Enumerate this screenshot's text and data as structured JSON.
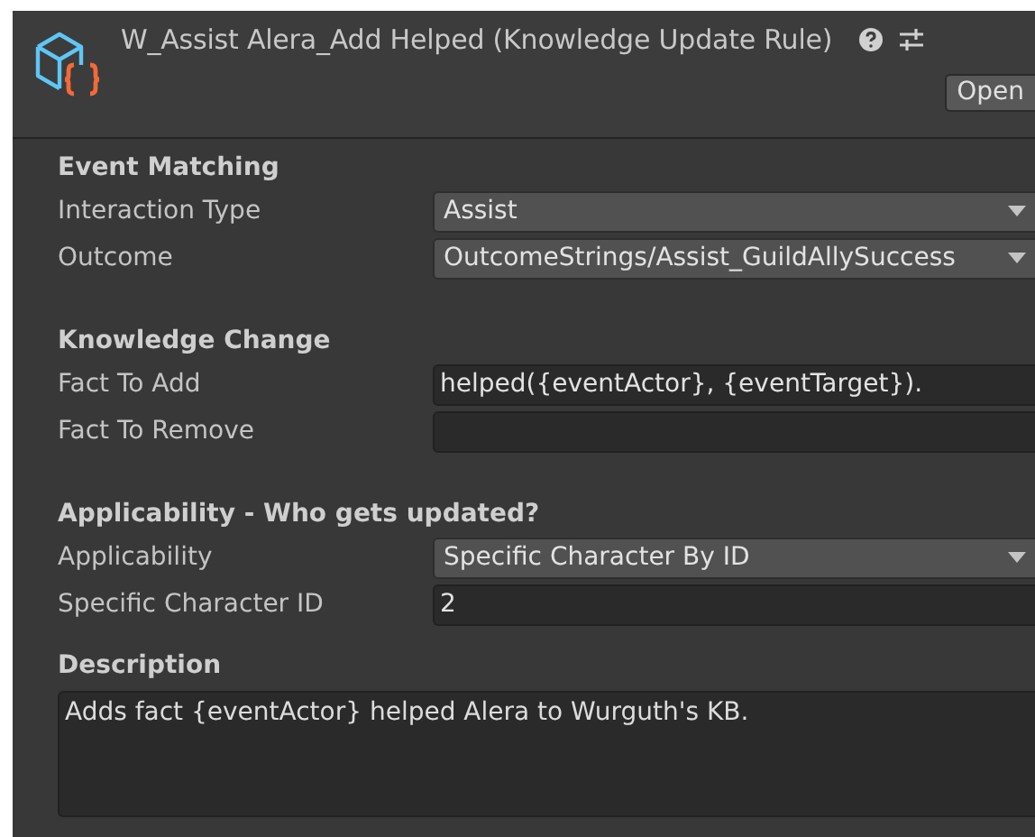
{
  "header": {
    "title": "W_Assist Alera_Add Helped (Knowledge Update Rule)",
    "open_button": "Open"
  },
  "sections": [
    {
      "title": "Event Matching",
      "fields": [
        {
          "label": "Interaction Type",
          "kind": "dropdown",
          "value": "Assist"
        },
        {
          "label": "Outcome",
          "kind": "dropdown",
          "value": "OutcomeStrings/Assist_GuildAllySuccess"
        }
      ]
    },
    {
      "title": "Knowledge Change",
      "fields": [
        {
          "label": "Fact To Add",
          "kind": "text",
          "value": "helped({eventActor}, {eventTarget})."
        },
        {
          "label": "Fact To Remove",
          "kind": "text"
        }
      ]
    },
    {
      "title": "Applicability - Who gets updated?",
      "fields": [
        {
          "label": "Applicability",
          "kind": "dropdown",
          "value": "Specific Character By ID"
        },
        {
          "label": "Specific Character ID",
          "kind": "text",
          "value": "2"
        }
      ]
    }
  ],
  "description": {
    "title": "Description",
    "value": "Adds fact {eventActor} helped Alera to Wurguth's KB."
  }
}
